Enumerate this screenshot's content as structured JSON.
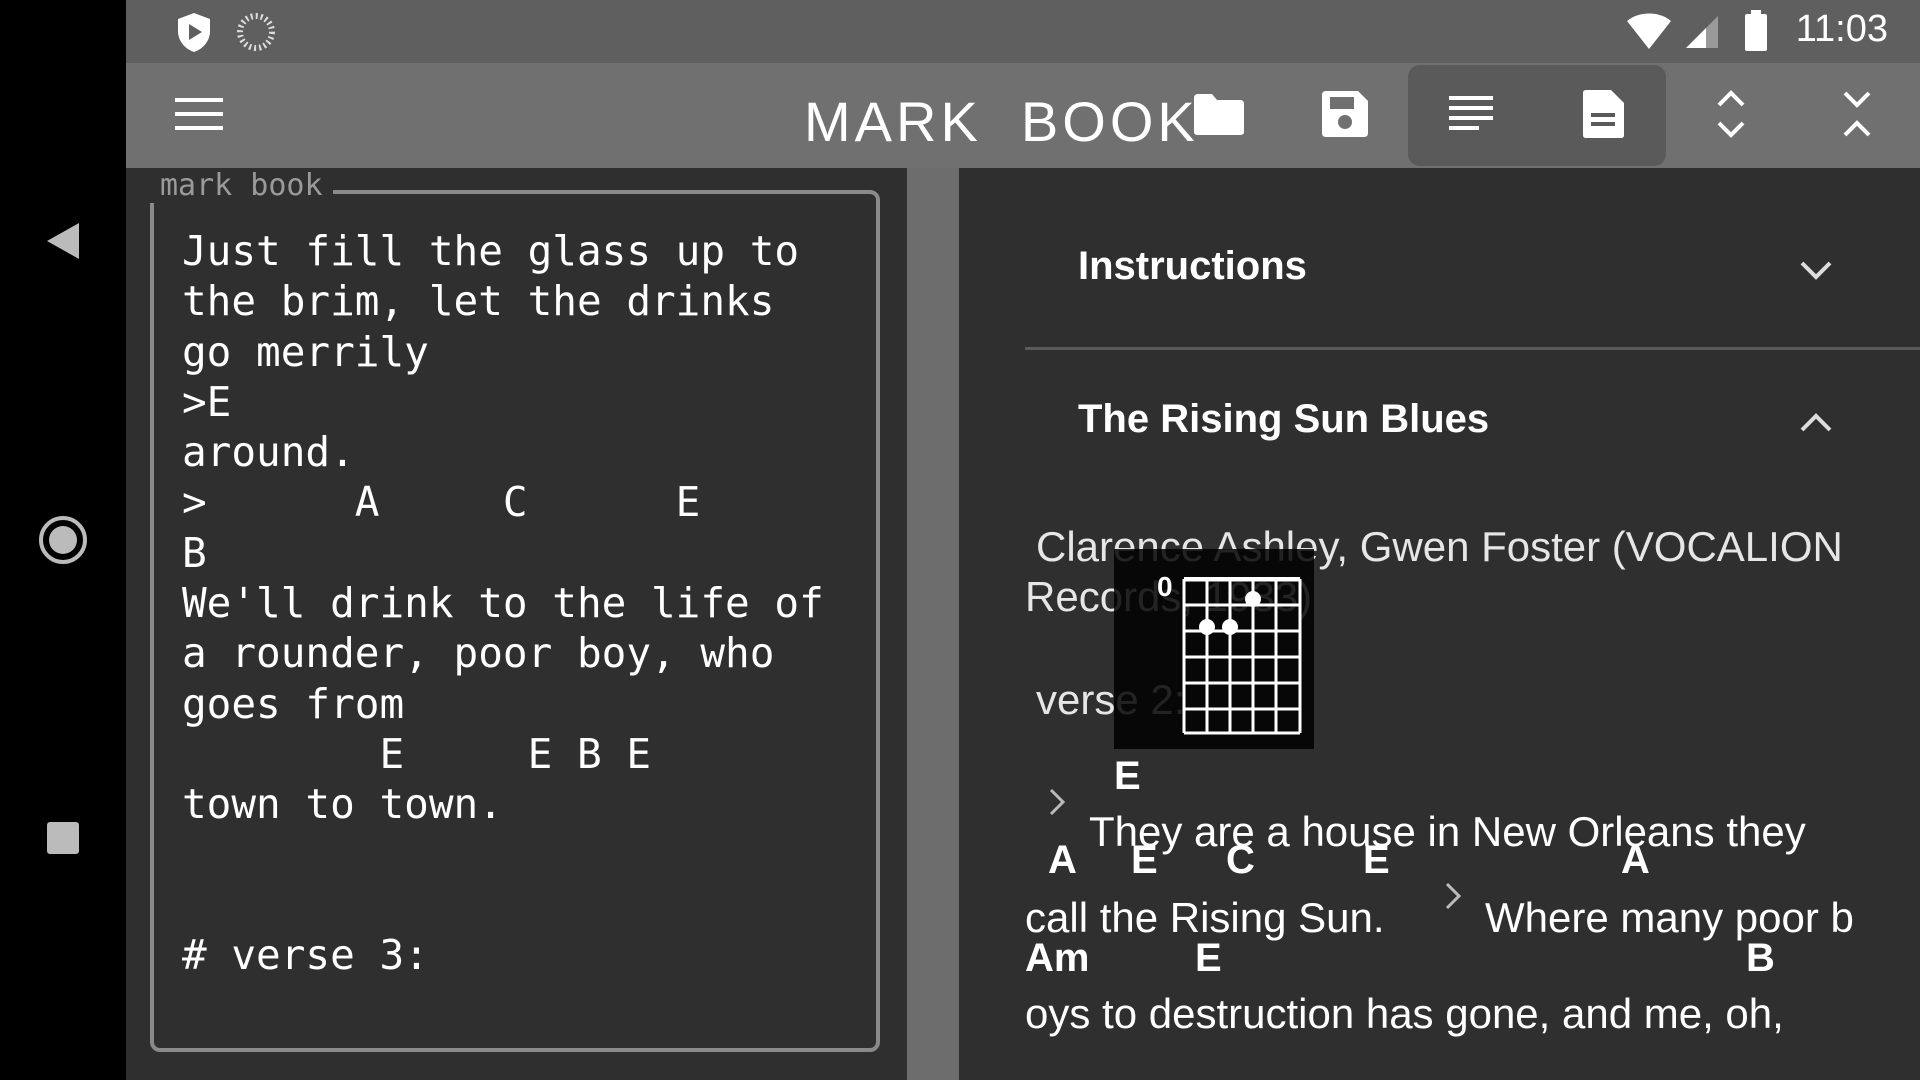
{
  "statusbar": {
    "time": "11:03",
    "icons": [
      "shield-play-icon",
      "sync-spinner-icon",
      "wifi-icon",
      "cell-signal-icon",
      "battery-icon"
    ]
  },
  "navbar": {
    "icons": [
      "back-icon",
      "home-icon",
      "recents-icon"
    ]
  },
  "appbar": {
    "title": "MARK  BOOK",
    "icons": [
      "menu-icon",
      "folder-icon",
      "save-icon",
      "text-view-icon",
      "document-view-icon",
      "expand-icon",
      "collapse-icon"
    ]
  },
  "editor": {
    "legend": "mark book",
    "text": "Just fill the glass up to\nthe brim, let the drinks\ngo merrily\n>E\naround.\n>      A     C      E\nB\nWe'll drink to the life of\na rounder, poor boy, who\ngoes from\n        E     E B E\ntown to town.\n\n\n# verse 3:"
  },
  "preview": {
    "sections": [
      {
        "title": "Instructions",
        "expanded": false
      },
      {
        "title": "The Rising Sun Blues",
        "expanded": true
      }
    ],
    "meta_line1": "Clarence Ashley, Gwen Foster (VOCALION",
    "meta_line2": "Records, 1933)",
    "verse_label": "verse 2:",
    "chords": {
      "c_e1": "E",
      "c_a1": "A",
      "c_e2": "E",
      "c_c": "C",
      "c_e3": "E",
      "c_a2": "A",
      "c_am": "Am",
      "c_e4": "E",
      "c_b": "B"
    },
    "lyrics": {
      "line1": "They  are  a  house  in  New  Orleans  they",
      "line2a": "call  the  Rising  Sun.",
      "line2b": "Where  many  poor  b",
      "line3": "oys  to  destruction  has  gone,  and  me,  oh,"
    },
    "chord_diagram": {
      "chord": "E",
      "base_fret": "0",
      "strings": 6,
      "frets": 6
    }
  }
}
